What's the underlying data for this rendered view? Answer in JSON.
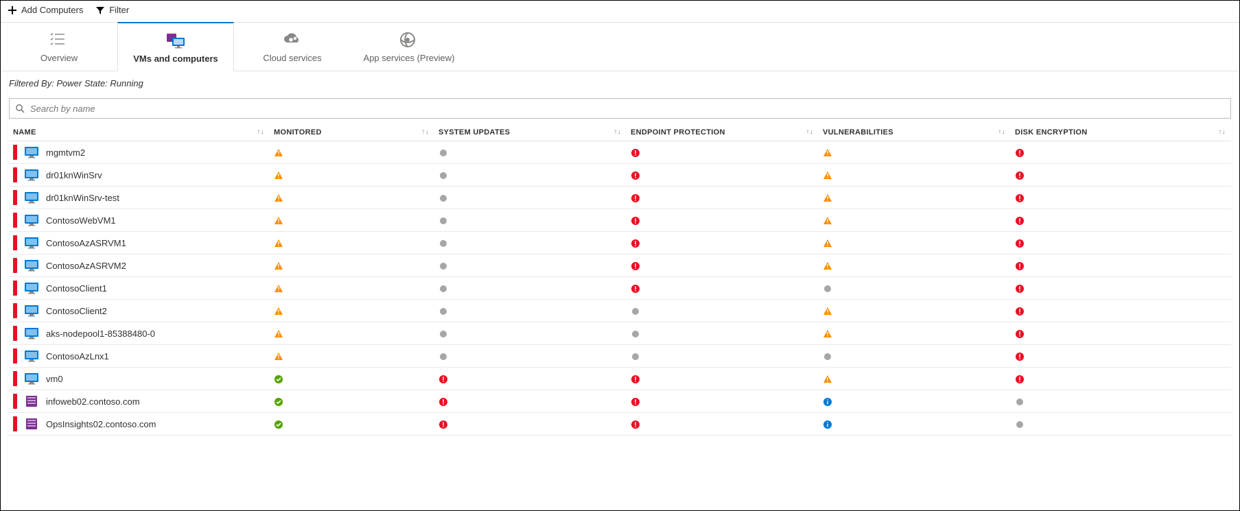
{
  "toolbar": {
    "add_label": "Add Computers",
    "filter_label": "Filter"
  },
  "tabs": [
    {
      "label": "Overview",
      "icon": "list",
      "active": false
    },
    {
      "label": "VMs and computers",
      "icon": "vm",
      "active": true
    },
    {
      "label": "Cloud services",
      "icon": "cloudcog",
      "active": false
    },
    {
      "label": "App services (Preview)",
      "icon": "apps",
      "active": false
    }
  ],
  "filter_text": "Filtered By: Power State: Running",
  "search": {
    "placeholder": "Search by name"
  },
  "columns": [
    {
      "label": "NAME"
    },
    {
      "label": "MONITORED"
    },
    {
      "label": "SYSTEM UPDATES"
    },
    {
      "label": "ENDPOINT PROTECTION"
    },
    {
      "label": "VULNERABILITIES"
    },
    {
      "label": "DISK ENCRYPTION"
    }
  ],
  "rows": [
    {
      "name": "mgmtvm2",
      "type": "vm",
      "monitored": "warn",
      "system_updates": "none",
      "endpoint": "error",
      "vuln": "warn",
      "disk": "error"
    },
    {
      "name": "dr01knWinSrv",
      "type": "vm",
      "monitored": "warn",
      "system_updates": "none",
      "endpoint": "error",
      "vuln": "warn",
      "disk": "error"
    },
    {
      "name": "dr01knWinSrv-test",
      "type": "vm",
      "monitored": "warn",
      "system_updates": "none",
      "endpoint": "error",
      "vuln": "warn",
      "disk": "error"
    },
    {
      "name": "ContosoWebVM1",
      "type": "vm",
      "monitored": "warn",
      "system_updates": "none",
      "endpoint": "error",
      "vuln": "warn",
      "disk": "error"
    },
    {
      "name": "ContosoAzASRVM1",
      "type": "vm",
      "monitored": "warn",
      "system_updates": "none",
      "endpoint": "error",
      "vuln": "warn",
      "disk": "error"
    },
    {
      "name": "ContosoAzASRVM2",
      "type": "vm",
      "monitored": "warn",
      "system_updates": "none",
      "endpoint": "error",
      "vuln": "warn",
      "disk": "error"
    },
    {
      "name": "ContosoClient1",
      "type": "vm",
      "monitored": "warn",
      "system_updates": "none",
      "endpoint": "error",
      "vuln": "none",
      "disk": "error"
    },
    {
      "name": "ContosoClient2",
      "type": "vm",
      "monitored": "warn",
      "system_updates": "none",
      "endpoint": "none",
      "vuln": "warn",
      "disk": "error"
    },
    {
      "name": "aks-nodepool1-85388480-0",
      "type": "vm",
      "monitored": "warn",
      "system_updates": "none",
      "endpoint": "none",
      "vuln": "warn",
      "disk": "error"
    },
    {
      "name": "ContosoAzLnx1",
      "type": "vm",
      "monitored": "warn",
      "system_updates": "none",
      "endpoint": "none",
      "vuln": "none",
      "disk": "error"
    },
    {
      "name": "vm0",
      "type": "vm",
      "monitored": "ok",
      "system_updates": "error",
      "endpoint": "error",
      "vuln": "warn",
      "disk": "error"
    },
    {
      "name": "infoweb02.contoso.com",
      "type": "host",
      "monitored": "ok",
      "system_updates": "error",
      "endpoint": "error",
      "vuln": "info",
      "disk": "none"
    },
    {
      "name": "OpsInsights02.contoso.com",
      "type": "host",
      "monitored": "ok",
      "system_updates": "error",
      "endpoint": "error",
      "vuln": "info",
      "disk": "none"
    }
  ],
  "icons": {
    "warn": "warning-icon",
    "error": "error-icon",
    "ok": "ok-icon",
    "info": "info-icon",
    "none": "none-icon"
  }
}
